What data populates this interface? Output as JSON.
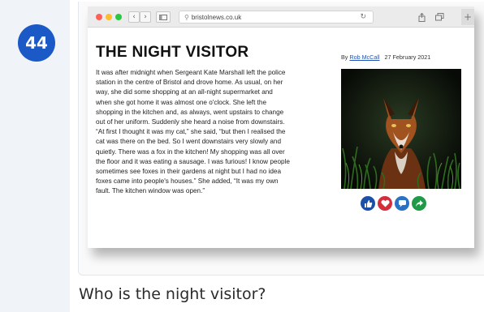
{
  "question": {
    "number": "44",
    "text": "Who is the night visitor?"
  },
  "browser": {
    "url": "bristolnews.co.uk",
    "back_icon": "chevron-left-icon",
    "forward_icon": "chevron-right-icon",
    "colors": {
      "close": "#fe5f57",
      "minimize": "#febc2e",
      "maximize": "#28c840"
    }
  },
  "article": {
    "headline": "THE NIGHT VISITOR",
    "byline_prefix": "By",
    "author": "Rob McCall",
    "date": "27 February 2021",
    "lines": [
      "It was after midnight when Sergeant Kate Marshall left the police",
      "station in the centre of Bristol and drove home. As usual, on her",
      "way, she did some shopping at an all-night supermarket and",
      "when she got home it was almost one o'clock. She left the",
      "shopping in the kitchen and, as always, went upstairs to change",
      "out of her uniform. Suddenly she heard a noise from downstairs.",
      "“At first I thought it was my cat,” she said, “but then I realised the",
      "cat was there on the bed. So I went downstairs very slowly and",
      "quietly. There was a fox in the kitchen! My shopping was all over",
      "the floor and it was eating a sausage. I was furious! I know people",
      "sometimes see foxes in their gardens at night but I had no idea",
      "foxes came into people's houses.” She added, “It was my own",
      "fault. The kitchen window was open.”"
    ],
    "share_buttons": [
      {
        "name": "like-icon",
        "color": "#1b4fa8"
      },
      {
        "name": "heart-icon",
        "color": "#d42e3c"
      },
      {
        "name": "comment-icon",
        "color": "#2a72c4"
      },
      {
        "name": "share-arrow-icon",
        "color": "#1f9a47"
      }
    ]
  }
}
